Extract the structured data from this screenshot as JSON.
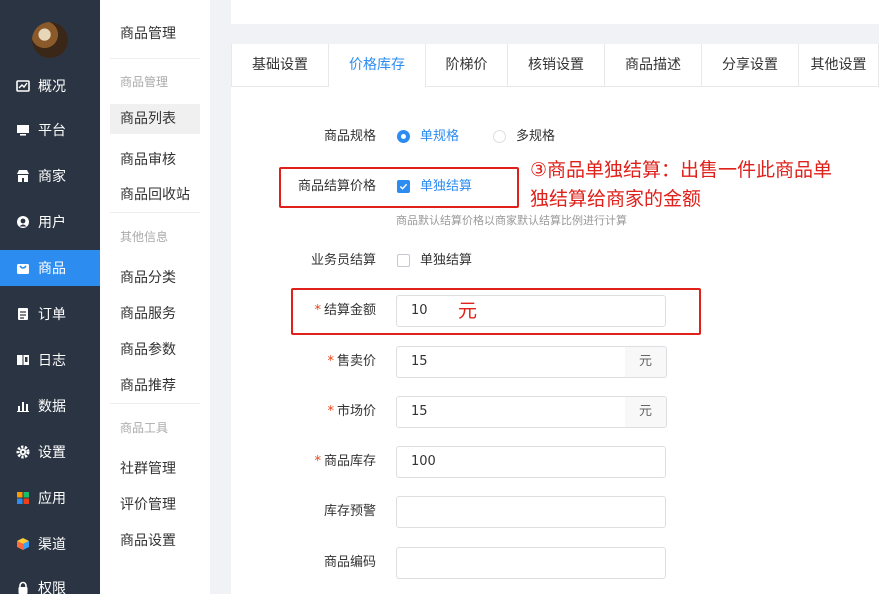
{
  "sidebar": {
    "items": [
      {
        "label": "概况",
        "icon": "dashboard-icon",
        "active": false
      },
      {
        "label": "平台",
        "icon": "monitor-icon",
        "active": false
      },
      {
        "label": "商家",
        "icon": "store-icon",
        "active": false
      },
      {
        "label": "用户",
        "icon": "user-icon",
        "active": false
      },
      {
        "label": "商品",
        "icon": "bag-icon",
        "active": true
      },
      {
        "label": "订单",
        "icon": "document-icon",
        "active": false
      },
      {
        "label": "日志",
        "icon": "book-icon",
        "active": false
      },
      {
        "label": "数据",
        "icon": "bar-chart-icon",
        "active": false
      },
      {
        "label": "设置",
        "icon": "gear-icon",
        "active": false
      },
      {
        "label": "应用",
        "icon": "apps-icon",
        "active": false
      },
      {
        "label": "渠道",
        "icon": "cube-icon",
        "active": false
      },
      {
        "label": "权限",
        "icon": "lock-icon",
        "active": false
      }
    ],
    "accent": "#2d8cf0"
  },
  "subnav": {
    "title": "商品管理",
    "groups": [
      {
        "label": "商品管理",
        "items": [
          "商品列表",
          "商品审核",
          "商品回收站"
        ]
      },
      {
        "label": "其他信息",
        "items": [
          "商品分类",
          "商品服务",
          "商品参数",
          "商品推荐"
        ]
      },
      {
        "label": "商品工具",
        "items": [
          "社群管理",
          "评价管理",
          "商品设置"
        ]
      }
    ],
    "active_item": "商品列表"
  },
  "tabs": [
    {
      "label": "基础设置",
      "active": false
    },
    {
      "label": "价格库存",
      "active": true
    },
    {
      "label": "阶梯价",
      "active": false
    },
    {
      "label": "核销设置",
      "active": false
    },
    {
      "label": "商品描述",
      "active": false
    },
    {
      "label": "分享设置",
      "active": false
    },
    {
      "label": "其他设置",
      "active": false
    }
  ],
  "form": {
    "spec": {
      "label": "商品规格",
      "options": [
        {
          "label": "单规格",
          "checked": true
        },
        {
          "label": "多规格",
          "checked": false
        }
      ]
    },
    "settle_price": {
      "label": "商品结算价格",
      "checkbox_label": "单独结算",
      "checked": true,
      "hint": "商品默认结算价格以商家默认结算比例进行计算"
    },
    "salesman": {
      "label": "业务员结算",
      "checkbox_label": "单独结算",
      "checked": false
    },
    "settle_amount": {
      "label": "结算金额",
      "value": "10",
      "required": true
    },
    "sale_price": {
      "label": "售卖价",
      "value": "15",
      "unit": "元",
      "required": true
    },
    "market_price": {
      "label": "市场价",
      "value": "15",
      "unit": "元",
      "required": true
    },
    "stock": {
      "label": "商品库存",
      "value": "100",
      "required": true
    },
    "stock_warning": {
      "label": "库存预警",
      "value": ""
    },
    "sku_code": {
      "label": "商品编码",
      "value": ""
    }
  },
  "annotations": {
    "note": "③商品单独结算：出售一件此商品单独结算给商家的金额",
    "note_line1": "③商品单独结算：出售一件此商品单",
    "note_line2": "独结算给商家的金额",
    "unit_note": "元",
    "color": "#e0201a"
  }
}
